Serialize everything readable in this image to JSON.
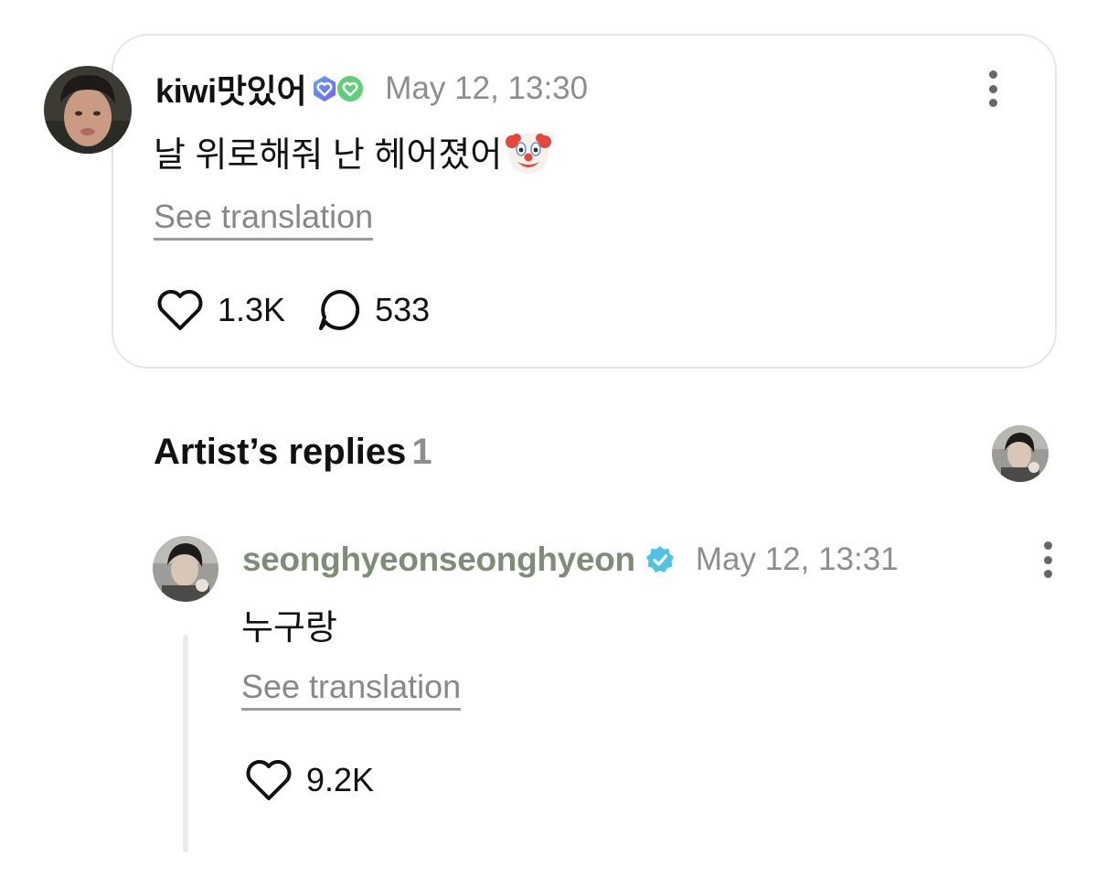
{
  "post": {
    "author": "kiwi맛있어",
    "timestamp": "May 12, 13:30",
    "text": "날 위로해줘 난 헤어졌어",
    "see_translation": "See translation",
    "likes": "1.3K",
    "comments": "533",
    "badge_icons": [
      "hexagon-heart-badge-icon",
      "green-heart-badge-icon"
    ],
    "emoji": "clown-face-icon"
  },
  "artist_replies": {
    "title": "Artist’s replies",
    "count": "1"
  },
  "reply": {
    "author": "seonghyeonseonghyeon",
    "timestamp": "May 12, 13:31",
    "text": "누구랑",
    "see_translation": "See translation",
    "likes": "9.2K"
  },
  "colors": {
    "artist_name": "#7f8c78",
    "verified": "#4fc3e0",
    "muted_text": "#8e8e8e",
    "card_border": "#e6e6e6"
  }
}
